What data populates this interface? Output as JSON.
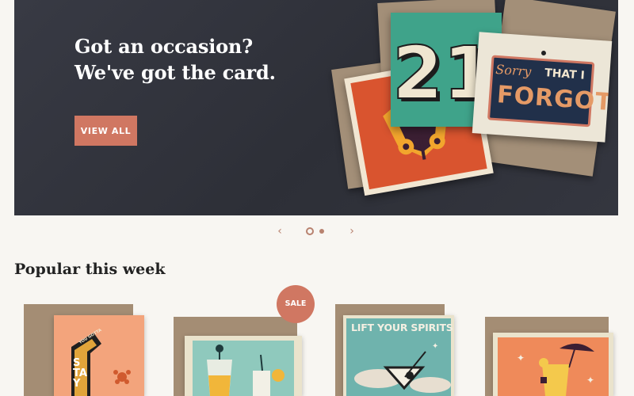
{
  "hero": {
    "title": "Got an occasion? We've got the card.",
    "button_label": "VIEW ALL",
    "card_number": "21",
    "card_sorry": "Sorry",
    "card_that_i": "THAT I",
    "card_forgot": "FORGOT"
  },
  "carousel": {
    "prev_icon": "‹",
    "next_icon": "›",
    "slide_count": 2,
    "active_slide": 1
  },
  "section": {
    "title": "Popular this week"
  },
  "products": [
    {
      "card_text_small": "YOU GOTTA",
      "card_text_big": "STAY"
    },
    {
      "badge": "SALE"
    },
    {
      "card_text": "LIFT YOUR SPIRITS"
    },
    {}
  ],
  "colors": {
    "accent": "#d07762",
    "hero_bg": "#33353e",
    "envelope": "#a38f78"
  }
}
